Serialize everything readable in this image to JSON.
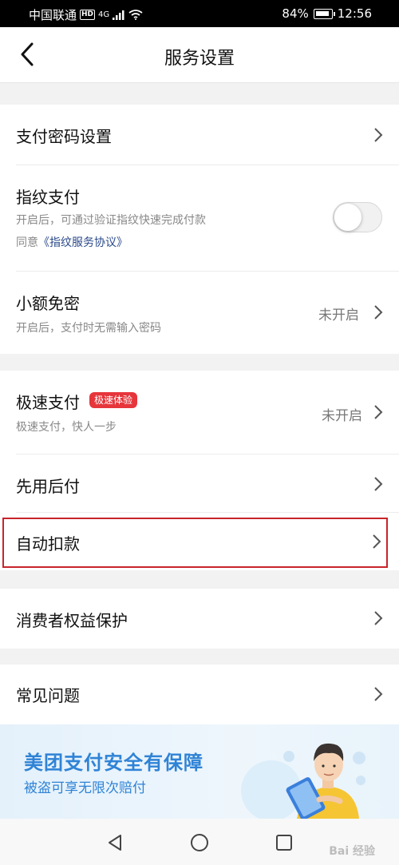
{
  "status_bar": {
    "carrier": "中国联通",
    "hd": "HD",
    "network": "4G",
    "battery": "84%",
    "time": "12:56"
  },
  "header": {
    "title": "服务设置"
  },
  "rows": {
    "payment_password": {
      "title": "支付密码设置"
    },
    "fingerprint": {
      "title": "指纹支付",
      "subtitle": "开启后，可通过验证指纹快速完成付款",
      "agreement_prefix": "同意",
      "agreement_link": "《指纹服务协议》",
      "toggle_on": false
    },
    "small_amount": {
      "title": "小额免密",
      "subtitle": "开启后，支付时无需输入密码",
      "status": "未开启"
    },
    "express_pay": {
      "title": "极速支付",
      "badge": "极速体验",
      "subtitle": "极速支付，快人一步",
      "status": "未开启"
    },
    "pay_later": {
      "title": "先用后付"
    },
    "auto_debit": {
      "title": "自动扣款"
    },
    "consumer_protection": {
      "title": "消费者权益保护"
    },
    "faq": {
      "title": "常见问题"
    }
  },
  "banner": {
    "title": "美团支付安全有保障",
    "subtitle": "被盗可享无限次赔付"
  },
  "watermark": "Bai 经验",
  "colors": {
    "highlight": "#c8242b",
    "badge": "#e6353b",
    "banner_text": "#2f83d6",
    "link": "#2b4a8a"
  },
  "icons": [
    "back-arrow-icon",
    "chevron-right-icon",
    "wifi-icon",
    "battery-icon",
    "back-triangle-icon",
    "home-circle-icon",
    "recents-square-icon"
  ]
}
